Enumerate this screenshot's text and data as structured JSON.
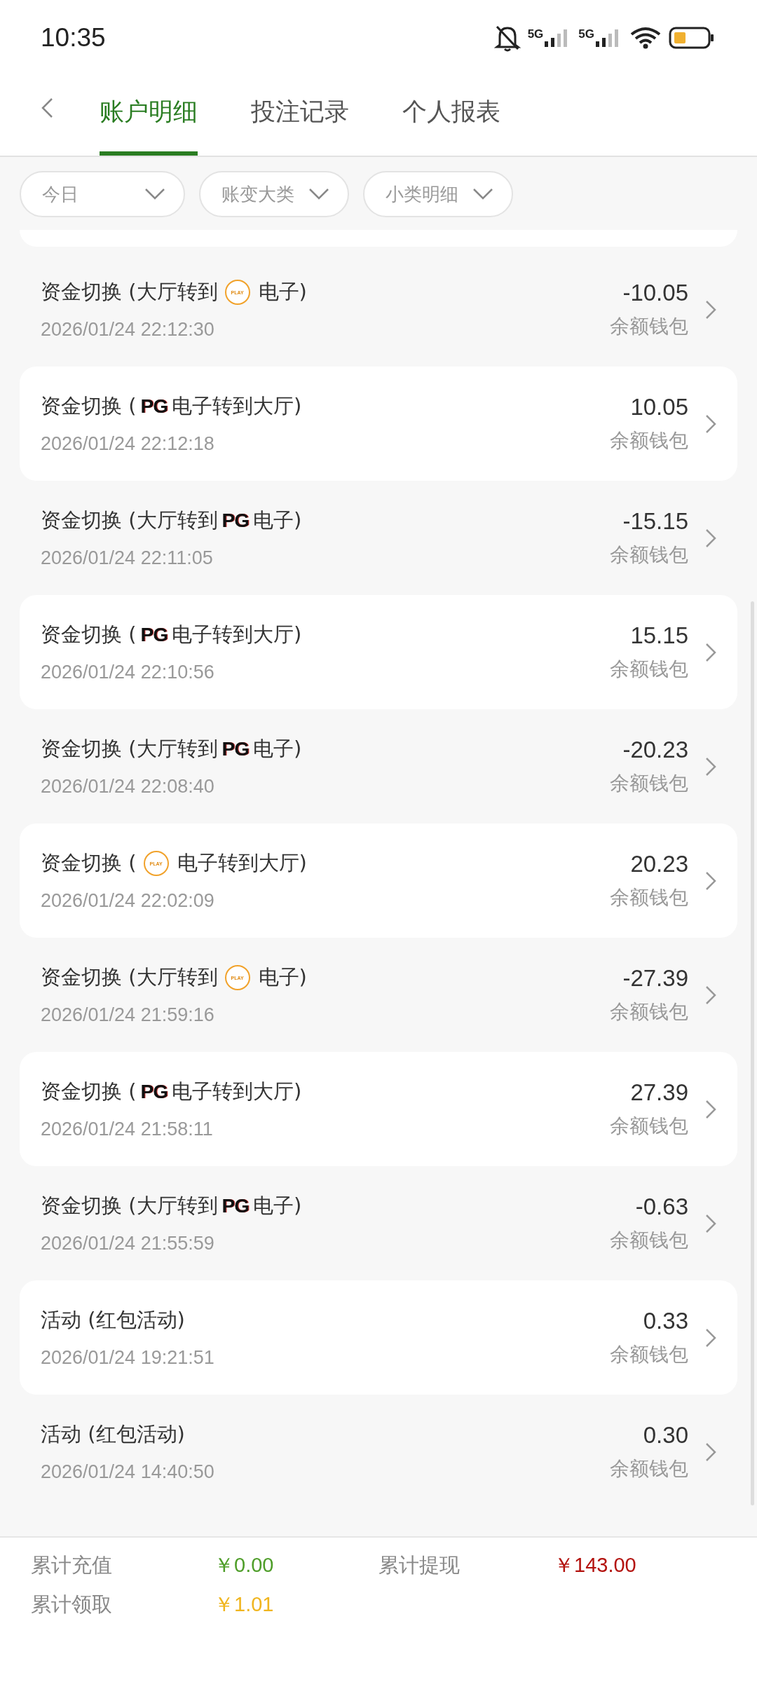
{
  "status_bar": {
    "time": "10:35",
    "network_labels": [
      "5G",
      "5G"
    ]
  },
  "tabs": [
    {
      "label": "账户明细",
      "selected": true
    },
    {
      "label": "投注记录",
      "selected": false
    },
    {
      "label": "个人报表",
      "selected": false
    }
  ],
  "filters": [
    {
      "label": "今日"
    },
    {
      "label": "账变大类"
    },
    {
      "label": "小类明细"
    }
  ],
  "records": [
    {
      "title_before": "资金切换 (大厅转到",
      "logo": {
        "kind": "play",
        "text": "PLAY"
      },
      "title_after": "电子)",
      "time": "2026/01/24 22:12:30",
      "amount": "-10.05",
      "wallet": "余额钱包"
    },
    {
      "title_before": "资金切换 (",
      "logo": {
        "kind": "pg",
        "text": "PG"
      },
      "title_after": "电子转到大厅)",
      "time": "2026/01/24 22:12:18",
      "amount": "10.05",
      "wallet": "余额钱包"
    },
    {
      "title_before": "资金切换 (大厅转到",
      "logo": {
        "kind": "pg",
        "text": "PG"
      },
      "title_after": "电子)",
      "time": "2026/01/24 22:11:05",
      "amount": "-15.15",
      "wallet": "余额钱包"
    },
    {
      "title_before": "资金切换 (",
      "logo": {
        "kind": "pg",
        "text": "PG"
      },
      "title_after": "电子转到大厅)",
      "time": "2026/01/24 22:10:56",
      "amount": "15.15",
      "wallet": "余额钱包"
    },
    {
      "title_before": "资金切换 (大厅转到",
      "logo": {
        "kind": "pg",
        "text": "PG"
      },
      "title_after": "电子)",
      "time": "2026/01/24 22:08:40",
      "amount": "-20.23",
      "wallet": "余额钱包"
    },
    {
      "title_before": "资金切换 (",
      "logo": {
        "kind": "play",
        "text": "PLAY"
      },
      "title_after": "电子转到大厅)",
      "time": "2026/01/24 22:02:09",
      "amount": "20.23",
      "wallet": "余额钱包"
    },
    {
      "title_before": "资金切换 (大厅转到",
      "logo": {
        "kind": "play",
        "text": "PLAY"
      },
      "title_after": "电子)",
      "time": "2026/01/24 21:59:16",
      "amount": "-27.39",
      "wallet": "余额钱包"
    },
    {
      "title_before": "资金切换 (",
      "logo": {
        "kind": "pg",
        "text": "PG"
      },
      "title_after": "电子转到大厅)",
      "time": "2026/01/24 21:58:11",
      "amount": "27.39",
      "wallet": "余额钱包"
    },
    {
      "title_before": "资金切换 (大厅转到",
      "logo": {
        "kind": "pg",
        "text": "PG"
      },
      "title_after": "电子)",
      "time": "2026/01/24 21:55:59",
      "amount": "-0.63",
      "wallet": "余额钱包"
    },
    {
      "title_before": "活动 (红包活动)",
      "time": "2026/01/24 19:21:51",
      "amount": "0.33",
      "wallet": "余额钱包"
    },
    {
      "title_before": "活动 (红包活动)",
      "time": "2026/01/24 14:40:50",
      "amount": "0.30",
      "wallet": "余额钱包"
    }
  ],
  "summary": [
    {
      "label": "累计充值",
      "value": "￥0.00",
      "color": "#4f9e2a"
    },
    {
      "label": "累计提现",
      "value": "￥143.00",
      "color": "#b3120e"
    },
    {
      "label": "累计领取",
      "value": "￥1.01",
      "color": "#f0b51e"
    }
  ]
}
